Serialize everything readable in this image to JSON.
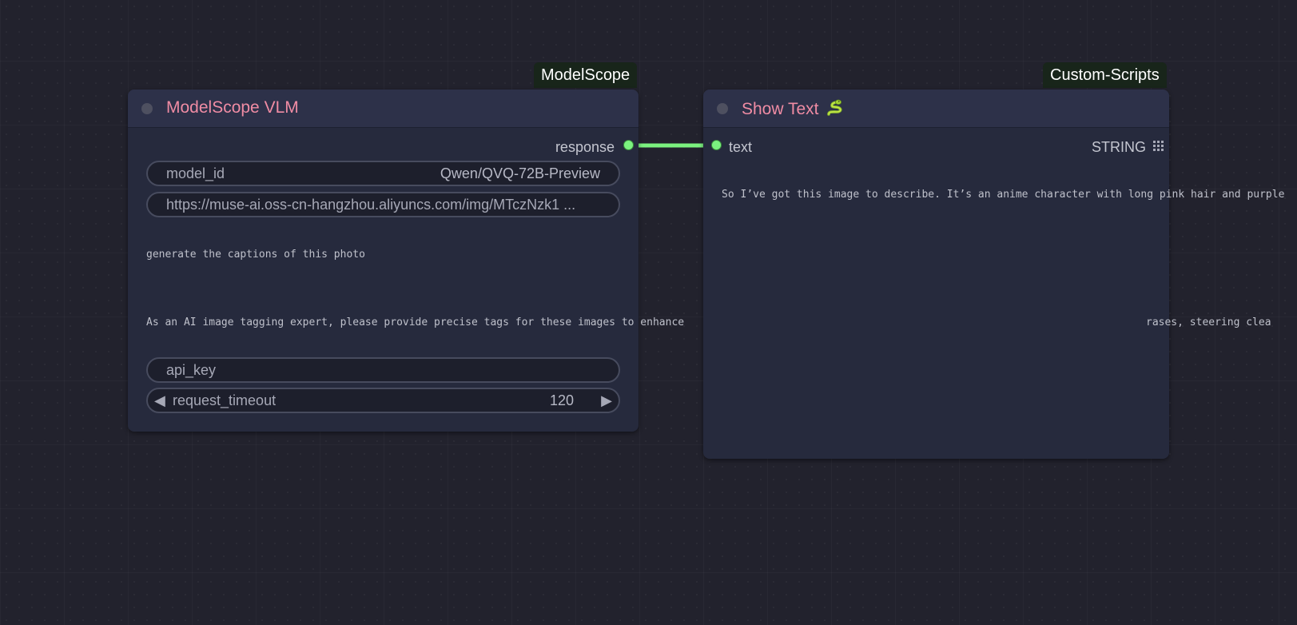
{
  "colors": {
    "canvas_bg": "#22222d",
    "node_bg": "#262a3d",
    "node_header": "#2d3149",
    "title": "#f08ca4",
    "link": "#7bf27f",
    "badge_bg": "#18251a"
  },
  "nodes": [
    {
      "badge": "ModelScope",
      "title": "ModelScope VLM",
      "output_label": "response",
      "widgets": {
        "model_id_label": "model_id",
        "model_id_value": "Qwen/QVQ-72B-Preview",
        "image_url": "https://muse-ai.oss-cn-hangzhou.aliyuncs.com/img/MTczNzk1 ...",
        "prompt": "generate the captions of this photo",
        "system_prompt": "As an AI image tagging expert, please provide precise tags for these images to enhance",
        "system_prompt_tail": "rases, steering clea",
        "api_key_label": "api_key",
        "timeout_label": "request_timeout",
        "timeout_value": "120",
        "decrement_icon": "left-triangle",
        "increment_icon": "right-triangle"
      }
    },
    {
      "badge": "Custom-Scripts",
      "title": "Show Text",
      "title_icon": "snake-emoji",
      "input_label": "text",
      "output_type": "STRING",
      "output_icon": "grid-icon",
      "text": "So I’ve got this image to describe. It’s an anime character with long pink hair and purple"
    }
  ]
}
